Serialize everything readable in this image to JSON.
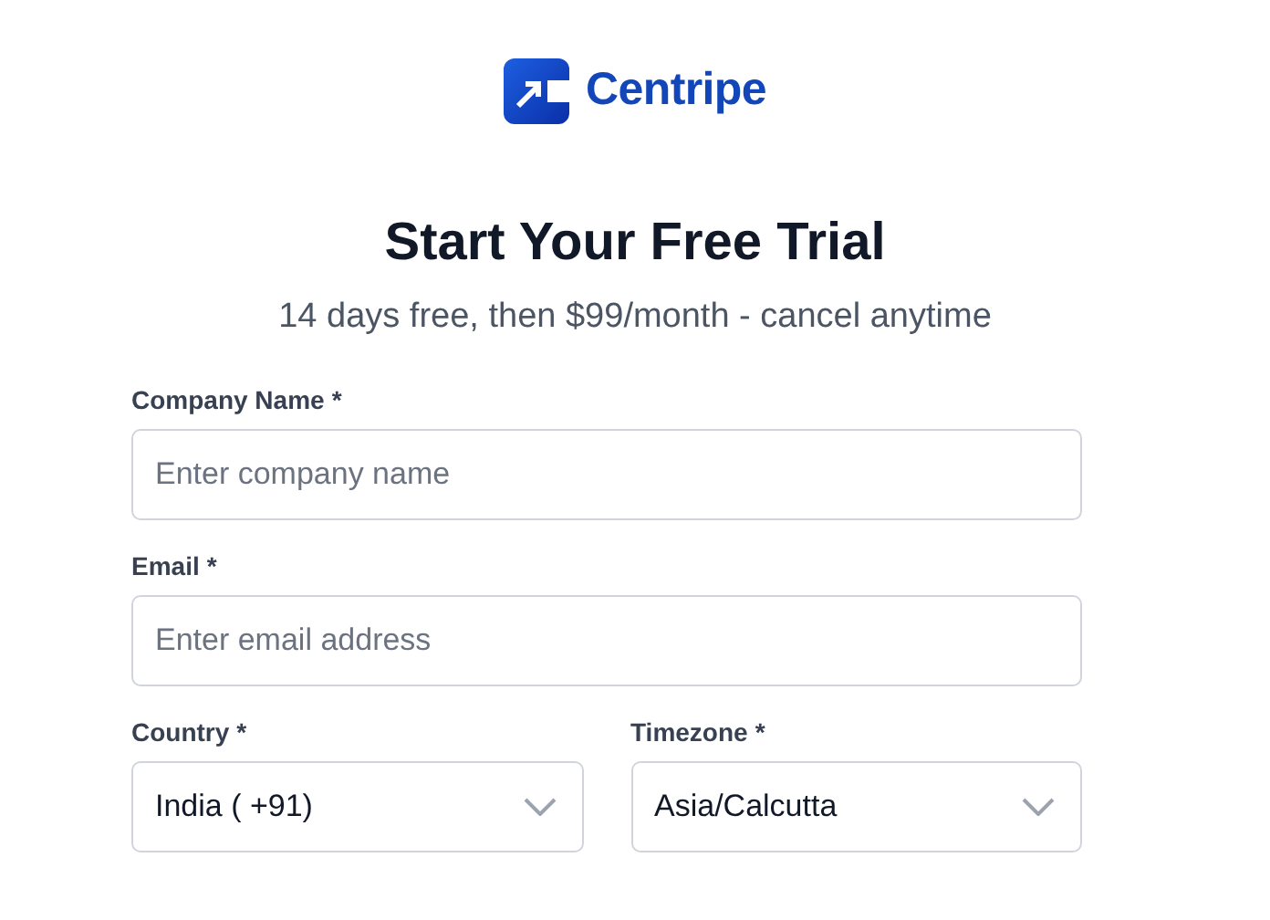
{
  "brand": {
    "name": "Centripe"
  },
  "heading": "Start Your Free Trial",
  "subheading": "14 days free, then $99/month - cancel anytime",
  "fields": [
    {
      "kind": "text",
      "label": "Company Name",
      "required_mark": "*",
      "placeholder": "Enter company name"
    },
    {
      "kind": "text",
      "label": "Email",
      "required_mark": "*",
      "placeholder": "Enter email address"
    },
    {
      "kind": "select",
      "label": "Country",
      "required_mark": "*",
      "value": "India ( +91)"
    },
    {
      "kind": "select",
      "label": "Timezone",
      "required_mark": "*",
      "value": "Asia/Calcutta"
    }
  ]
}
